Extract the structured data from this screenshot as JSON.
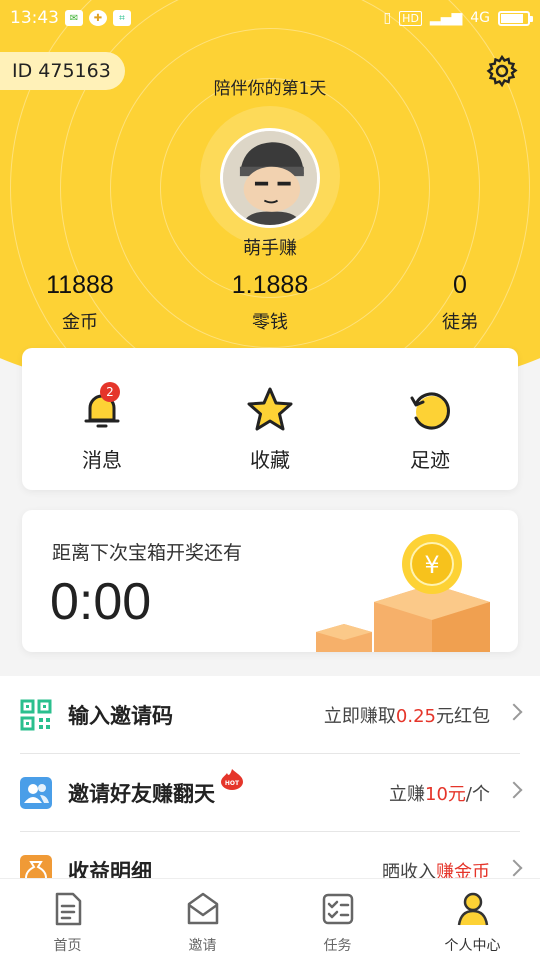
{
  "status_bar": {
    "time": "13:43",
    "network": "4G",
    "hd": "HD",
    "battery_percent": 85
  },
  "profile": {
    "id_label": "ID 475163",
    "days_text": "陪伴你的第1天",
    "nickname": "萌手赚"
  },
  "stats": [
    {
      "value": "11888",
      "label": "金币"
    },
    {
      "value": "1.1888",
      "label": "零钱"
    },
    {
      "value": "0",
      "label": "徒弟"
    }
  ],
  "quick_actions": [
    {
      "label": "消息",
      "icon": "bell-icon",
      "badge": "2"
    },
    {
      "label": "收藏",
      "icon": "star-icon"
    },
    {
      "label": "足迹",
      "icon": "history-icon"
    }
  ],
  "chest": {
    "label": "距离下次宝箱开奖还有",
    "time": "0:00",
    "coin_symbol": "¥"
  },
  "list": [
    {
      "title": "输入邀请码",
      "right_prefix": "立即赚取",
      "right_highlight": "0.25",
      "right_suffix": "元红包",
      "icon": "qrcode-icon"
    },
    {
      "title": "邀请好友赚翻天",
      "right_prefix": "立赚",
      "right_highlight": "10元",
      "right_suffix": "/个",
      "icon": "friends-icon",
      "tag": "HOT"
    },
    {
      "title": "收益明细",
      "right_prefix": "晒收入",
      "right_highlight": "赚金币",
      "right_suffix": "",
      "icon": "moneybag-icon"
    }
  ],
  "bottom_nav": [
    {
      "label": "首页",
      "icon": "home-doc-icon"
    },
    {
      "label": "邀请",
      "icon": "envelope-icon"
    },
    {
      "label": "任务",
      "icon": "tasks-icon"
    },
    {
      "label": "个人中心",
      "icon": "person-icon",
      "active": true
    }
  ],
  "colors": {
    "brand_yellow": "#fdd235",
    "highlight_red": "#e5352a",
    "icon_teal": "#2bbf8e",
    "icon_blue": "#4a9ee8",
    "icon_orange": "#f09a36"
  }
}
